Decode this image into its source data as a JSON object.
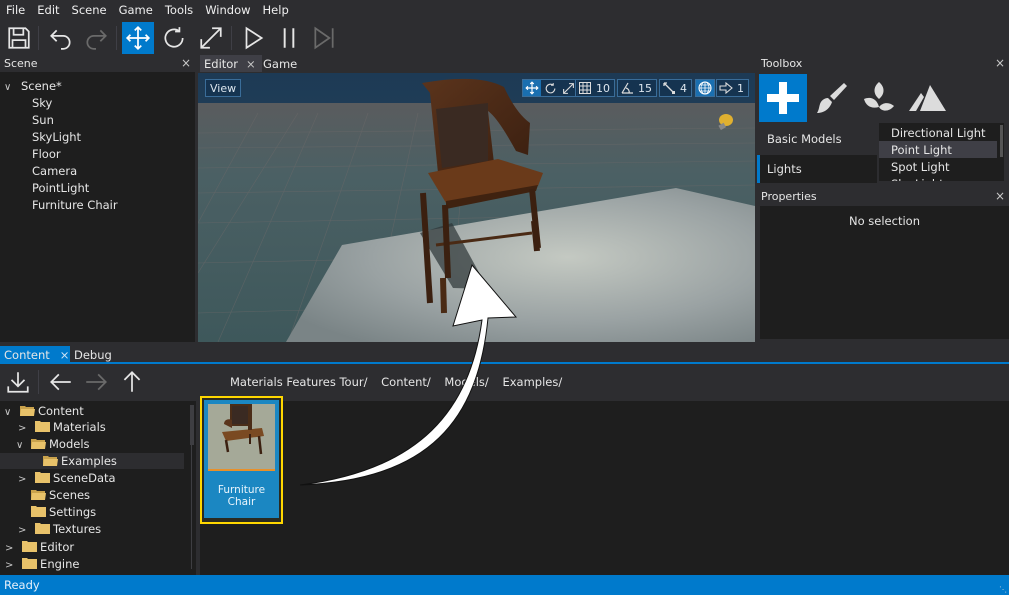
{
  "menu": [
    "File",
    "Edit",
    "Scene",
    "Game",
    "Tools",
    "Window",
    "Help"
  ],
  "toolbar": {
    "buttons": [
      {
        "name": "save",
        "icon": "save-icon"
      },
      {
        "name": "undo",
        "icon": "undo-icon"
      },
      {
        "name": "redo",
        "icon": "redo-icon",
        "disabled": true
      },
      {
        "name": "translate",
        "icon": "move-icon",
        "active": true
      },
      {
        "name": "rotate",
        "icon": "rotate-icon"
      },
      {
        "name": "scale",
        "icon": "scale-icon"
      },
      {
        "name": "play",
        "icon": "play-icon"
      },
      {
        "name": "pause",
        "icon": "pause-icon"
      },
      {
        "name": "step",
        "icon": "step-icon",
        "disabled": true
      }
    ]
  },
  "scene_panel": {
    "title": "Scene",
    "close": "×",
    "root": "Scene*",
    "items": [
      "Sky",
      "Sun",
      "SkyLight",
      "Floor",
      "Camera",
      "PointLight",
      "Furniture Chair"
    ]
  },
  "editor": {
    "tabs": [
      {
        "label": "Editor",
        "close": "×",
        "selected": true
      },
      {
        "label": "Game",
        "selected": false
      }
    ],
    "view_button": "View",
    "viewport_widgets": {
      "grid_snap": "10",
      "rotation_snap": "15",
      "scale_snap": "4",
      "camera_speed": "1"
    }
  },
  "toolbox": {
    "title": "Toolbox",
    "close": "×",
    "tools": [
      "spawn",
      "paint",
      "foliage",
      "terrain"
    ],
    "categories": [
      {
        "label": "Basic Models",
        "selected": false
      },
      {
        "label": "Lights",
        "selected": true
      }
    ],
    "lights": [
      "Directional Light",
      "Point Light",
      "Spot Light",
      "Sky Light"
    ],
    "hovered": "Point Light"
  },
  "properties": {
    "title": "Properties",
    "close": "×",
    "empty_text": "No selection"
  },
  "content": {
    "tabs": [
      {
        "label": "Content",
        "close": "×",
        "selected": true
      },
      {
        "label": "Debug",
        "selected": false
      }
    ],
    "breadcrumb": [
      "Materials Features Tour/",
      "Content/",
      "Models/",
      "Examples/"
    ],
    "tree": [
      {
        "label": "Content",
        "depth": 0,
        "expanded": true,
        "chevron": true
      },
      {
        "label": "Materials",
        "depth": 1,
        "chevron": true
      },
      {
        "label": "Models",
        "depth": 1,
        "expanded": true,
        "chevron": true
      },
      {
        "label": "Examples",
        "depth": 2,
        "selected": true
      },
      {
        "label": "SceneData",
        "depth": 1,
        "chevron": true
      },
      {
        "label": "Scenes",
        "depth": 1
      },
      {
        "label": "Settings",
        "depth": 1
      },
      {
        "label": "Textures",
        "depth": 1,
        "chevron": true
      },
      {
        "label": "Editor",
        "depth": 0,
        "chevron": true
      },
      {
        "label": "Engine",
        "depth": 0,
        "chevron": true
      }
    ],
    "items": [
      {
        "label_line1": "Furniture",
        "label_line2": "Chair",
        "selected": true
      }
    ]
  },
  "status": {
    "text": "Ready"
  },
  "colors": {
    "accent": "#007acc",
    "selection_outline": "#ffd700",
    "folder": "#e8c26a",
    "background": "#2d2d30",
    "panel": "#1e1e1e"
  }
}
